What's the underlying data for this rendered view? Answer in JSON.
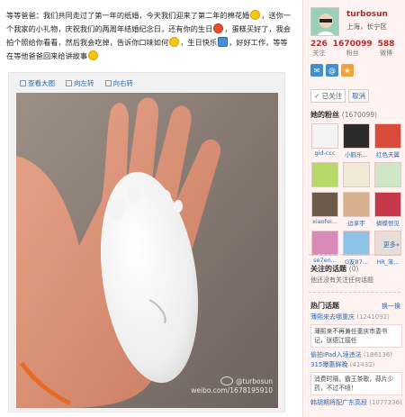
{
  "post": {
    "segments": [
      "等等爸爸：我们共同走过了第一年的纸婚，今天我们迎来了第二年的棉花婚",
      "，送你一个我家的小礼物，庆祝我们的两周年结婚纪念日，还有你的生日",
      "，蛋糕买好了，我会拍个照给你看看，然后我会吃掉，告诉你口味如何",
      "，生日快乐",
      "，好好工作，等等在等他爸爸回来给讲故事"
    ],
    "emoticons": [
      "smile-emoticon",
      "red-face-emoticon",
      "smile-emoticon",
      "cake-emoticon",
      "smile-emoticon"
    ]
  },
  "media_toolbar": {
    "view_large": "查看大图",
    "rotate_left": "向左转",
    "rotate_right": "向右转"
  },
  "watermark": {
    "handle": "@turbosun",
    "url": "weibo.com/1678195910"
  },
  "profile": {
    "name": "turbosun",
    "location": "上海，长宁区",
    "stats": [
      {
        "num": "226",
        "label": "关注"
      },
      {
        "num": "1670099",
        "label": "粉丝"
      },
      {
        "num": "588",
        "label": "微博"
      }
    ],
    "followed": "已关注",
    "cancel": "取消"
  },
  "fans_section": {
    "title": "她的粉丝",
    "count": "(1670099)",
    "fans": [
      {
        "name": "gid-ccc",
        "color": "#f3f3f3"
      },
      {
        "name": "小鹤乐...",
        "color": "#2b2b2b"
      },
      {
        "name": "红色天翼",
        "color": "#d94b3a"
      },
      {
        "name": "",
        "color": "#b6d96a"
      },
      {
        "name": "",
        "color": "#f0e9d8"
      },
      {
        "name": "",
        "color": "#cfe6c7"
      },
      {
        "name": "xiaofei...",
        "color": "#6b5a4a"
      },
      {
        "name": "边享宇",
        "color": "#d8b08f"
      },
      {
        "name": "蝴蝶恨见",
        "color": "#c43a4a"
      },
      {
        "name": "se7en...",
        "color": "#d98ab8"
      },
      {
        "name": "G友87...",
        "color": "#8ec3e8"
      },
      {
        "name": "HR_笨...",
        "color": "#e7ded8"
      }
    ],
    "more": "更多»"
  },
  "topics": {
    "title": "关注的话题",
    "count": "(0)",
    "empty": "他还没有关注任何话题"
  },
  "hot": {
    "title": "热门话题",
    "change": "换一换",
    "items": [
      {
        "topic": "薄熙来去哪重庆",
        "num": "(1241092)",
        "card": "薄熙来不再兼任重庆市委书记，张德江接任"
      },
      {
        "topic": "偷拍iPad入境违法",
        "num": "(186136)",
        "card": ""
      },
      {
        "topic": "315曝惠鲜晚",
        "num": "(41432)",
        "card": "消费时隔，霸王茶歌，蒜片少药，不过不喷！"
      },
      {
        "topic": "韩胡期将配广东高段",
        "num": "(1077236)",
        "card": ""
      }
    ]
  },
  "colors": {
    "accent": "#c42424",
    "link": "#2a6bb3",
    "sidebar_bg": "#fff3f1"
  }
}
